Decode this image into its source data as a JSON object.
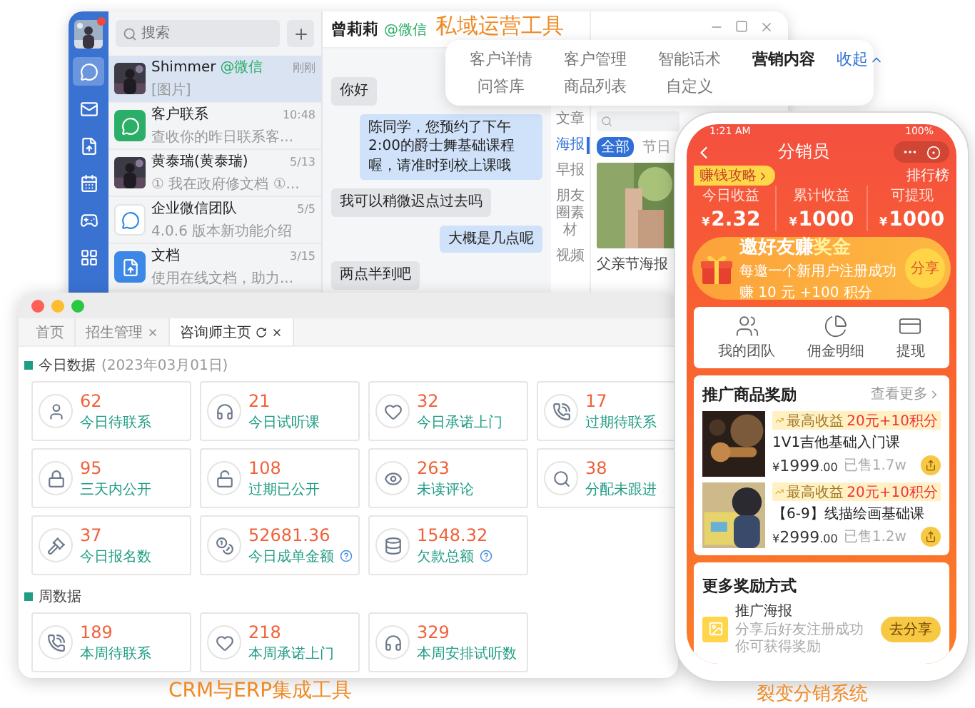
{
  "caption_private": "私域运营工具",
  "chat_window": {
    "search": {
      "placeholder": "搜索"
    },
    "contact_name": "曾莉莉",
    "contact_tag": "@微信",
    "conversations": [
      {
        "name": "Shimmer",
        "tag": "@微信",
        "preview": "[图片]",
        "time": "刚刚",
        "selected": true
      },
      {
        "kind": "chat",
        "name": "客户联系",
        "preview": "查收你的昨日联系客...",
        "time": "10:48",
        "selected": false
      },
      {
        "name": "黄泰瑞(黄泰瑞)",
        "preview": "① 我在政府修文档 ①...",
        "time": "5/13",
        "selected": false
      },
      {
        "kind": "work",
        "name": "企业微信团队",
        "preview": "4.0.6 版本新功能介绍",
        "time": "5/5",
        "selected": false
      },
      {
        "kind": "docs",
        "name": "文档",
        "preview": "使用在线文档，助力...",
        "time": "3/15",
        "selected": false
      }
    ],
    "messages": [
      {
        "text": "你好",
        "outgoing": false
      },
      {
        "text": "陈同学，您预约了下午2:00的爵士舞基础课程喔，请准时到校上课哦",
        "outgoing": true
      },
      {
        "text": "我可以稍微迟点过去吗",
        "outgoing": false
      },
      {
        "text": "大概是几点呢",
        "outgoing": true
      },
      {
        "text": "两点半到吧",
        "outgoing": false
      }
    ],
    "categories": [
      {
        "label": "文章",
        "selected": false
      },
      {
        "label": "海报",
        "selected": true
      },
      {
        "label": "早报",
        "selected": false
      },
      {
        "label": "朋友圈素材",
        "selected": false
      },
      {
        "label": "视频",
        "selected": false
      }
    ],
    "filters": [
      {
        "label": "全部",
        "selected": true
      },
      {
        "label": "节日",
        "selected": false
      }
    ],
    "material": {
      "title": "父亲节海报"
    }
  },
  "feature_menu": {
    "items": [
      {
        "label": "客户详情",
        "selected": false
      },
      {
        "label": "客户管理",
        "selected": false
      },
      {
        "label": "智能话术",
        "selected": false
      },
      {
        "label": "营销内容",
        "selected": true
      },
      {
        "label": "问答库",
        "selected": false
      },
      {
        "label": "商品列表",
        "selected": false
      },
      {
        "label": "自定义",
        "selected": false
      }
    ],
    "collapse": "收起"
  },
  "crm_window": {
    "tabs": [
      {
        "label": "首页",
        "selected": false,
        "closable": false
      },
      {
        "label": "招生管理",
        "selected": false,
        "closable": true
      },
      {
        "label": "咨询师主页",
        "selected": true,
        "closable": true
      }
    ],
    "sections": [
      {
        "title": "今日数据",
        "date": "(2023年03月01日)",
        "cards": [
          {
            "value": "62",
            "label": "今日待联系",
            "help": false
          },
          {
            "value": "21",
            "label": "今日试听课",
            "help": false
          },
          {
            "value": "32",
            "label": "今日承诺上门",
            "help": false
          },
          {
            "value": "17",
            "label": "过期待联系",
            "help": false
          },
          {
            "value": "95",
            "label": "三天内公开",
            "help": false
          },
          {
            "value": "108",
            "label": "过期已公开",
            "help": false
          },
          {
            "value": "263",
            "label": "未读评论",
            "help": false
          },
          {
            "value": "38",
            "label": "分配未跟进",
            "help": false
          },
          {
            "value": "37",
            "label": "今日报名数",
            "help": false
          },
          {
            "value": "52681.36",
            "label": "今日成单金额",
            "help": true
          },
          {
            "value": "1548.32",
            "label": "欠款总额",
            "help": true
          }
        ]
      },
      {
        "title": "周数据",
        "cards": [
          {
            "value": "189",
            "label": "本周待联系",
            "help": false
          },
          {
            "value": "218",
            "label": "本周承诺上门",
            "help": false
          },
          {
            "value": "329",
            "label": "本周安排试听数",
            "help": false
          }
        ]
      }
    ]
  },
  "caption_crm": "CRM与ERP集成工具",
  "phone": {
    "status_time": "1:21 AM",
    "battery": "100%",
    "title": "分销员",
    "guide": "赚钱攻略",
    "ranking": "排行榜",
    "stats": [
      {
        "label": "今日收益",
        "currency": "¥",
        "amount": "2.32"
      },
      {
        "label": "累计收益",
        "currency": "¥",
        "amount": "1000"
      },
      {
        "label": "可提现",
        "currency": "¥",
        "amount": "1000"
      }
    ],
    "banner": {
      "title": "邀好友赚",
      "title_highlight": "奖金",
      "line1": "每邀一个新用户注册成功",
      "line2": "赚 10 元 +100 积分",
      "button": "分享"
    },
    "shortcuts": [
      "我的团队",
      "佣金明细",
      "提现"
    ],
    "products_title": "推广商品奖励",
    "more": "查看更多",
    "products": [
      {
        "reward_label": "最高收益",
        "reward": "20元+10积分",
        "name": "1V1吉他基础入门课",
        "currency": "¥",
        "price": "1999",
        "cents": ".00",
        "sold": "已售1.7w"
      },
      {
        "reward_label": "最高收益",
        "reward": "20元+10积分",
        "name": "【6-9】线描绘画基础课",
        "currency": "¥",
        "price": "2999",
        "cents": ".00",
        "sold": "已售1.2w"
      }
    ],
    "more_rewards": {
      "title": "更多奖励方式",
      "items": [
        {
          "name": "推广海报",
          "description": "分享后好友注册成功你可获得奖励",
          "button": "去分享"
        }
      ]
    }
  },
  "caption_distribution": "裂变分销系统"
}
